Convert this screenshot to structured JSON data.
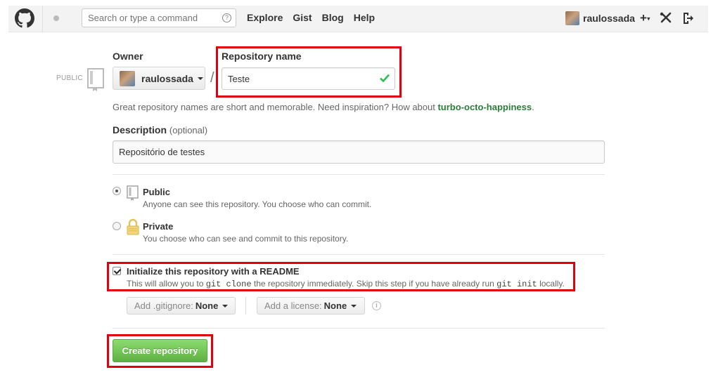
{
  "header": {
    "search": {
      "placeholder": "Search or type a command",
      "help_glyph": "?"
    },
    "nav": [
      "Explore",
      "Gist",
      "Blog",
      "Help"
    ],
    "username": "raulossada",
    "plus_icon": "+",
    "caret_icon": "▾"
  },
  "form": {
    "owner_label": "Owner",
    "owner_value": "raulossada",
    "visibility_tag": "PUBLIC",
    "slash": "/",
    "repo_name_label": "Repository name",
    "repo_name_value": "Teste",
    "hint_prefix": "Great repository names are short and memorable. Need inspiration? How about ",
    "hint_suggestion": "turbo-octo-happiness",
    "hint_suffix": ".",
    "description_label": "Description",
    "description_optional": "(optional)",
    "description_value": "Repositório de testes",
    "visibility": [
      {
        "title": "Public",
        "desc": "Anyone can see this repository. You choose who can commit.",
        "selected": true
      },
      {
        "title": "Private",
        "desc": "You choose who can see and commit to this repository.",
        "selected": false
      }
    ],
    "readme": {
      "title": "Initialize this repository with a README",
      "desc_1": "This will allow you to ",
      "code_1": "git clone",
      "desc_2": " the repository immediately. Skip this step if you have already run ",
      "code_2": "git init",
      "desc_3": " locally.",
      "checked": true
    },
    "gitignore": {
      "label": "Add .gitignore:",
      "value": "None"
    },
    "license": {
      "label": "Add a license:",
      "value": "None"
    },
    "info_glyph": "i",
    "create_button": "Create repository"
  },
  "colors": {
    "highlight_box": "#e0000e",
    "create_button": "#60b044",
    "suggestion": "#2a7d38",
    "check_ok": "#2cbe4e"
  },
  "icons": [
    "github-octocat-icon",
    "notification-dot-icon",
    "search-help-icon",
    "plus-icon",
    "tools-icon",
    "sign-out-icon",
    "repo-book-icon",
    "check-icon",
    "lock-icon",
    "info-icon"
  ]
}
